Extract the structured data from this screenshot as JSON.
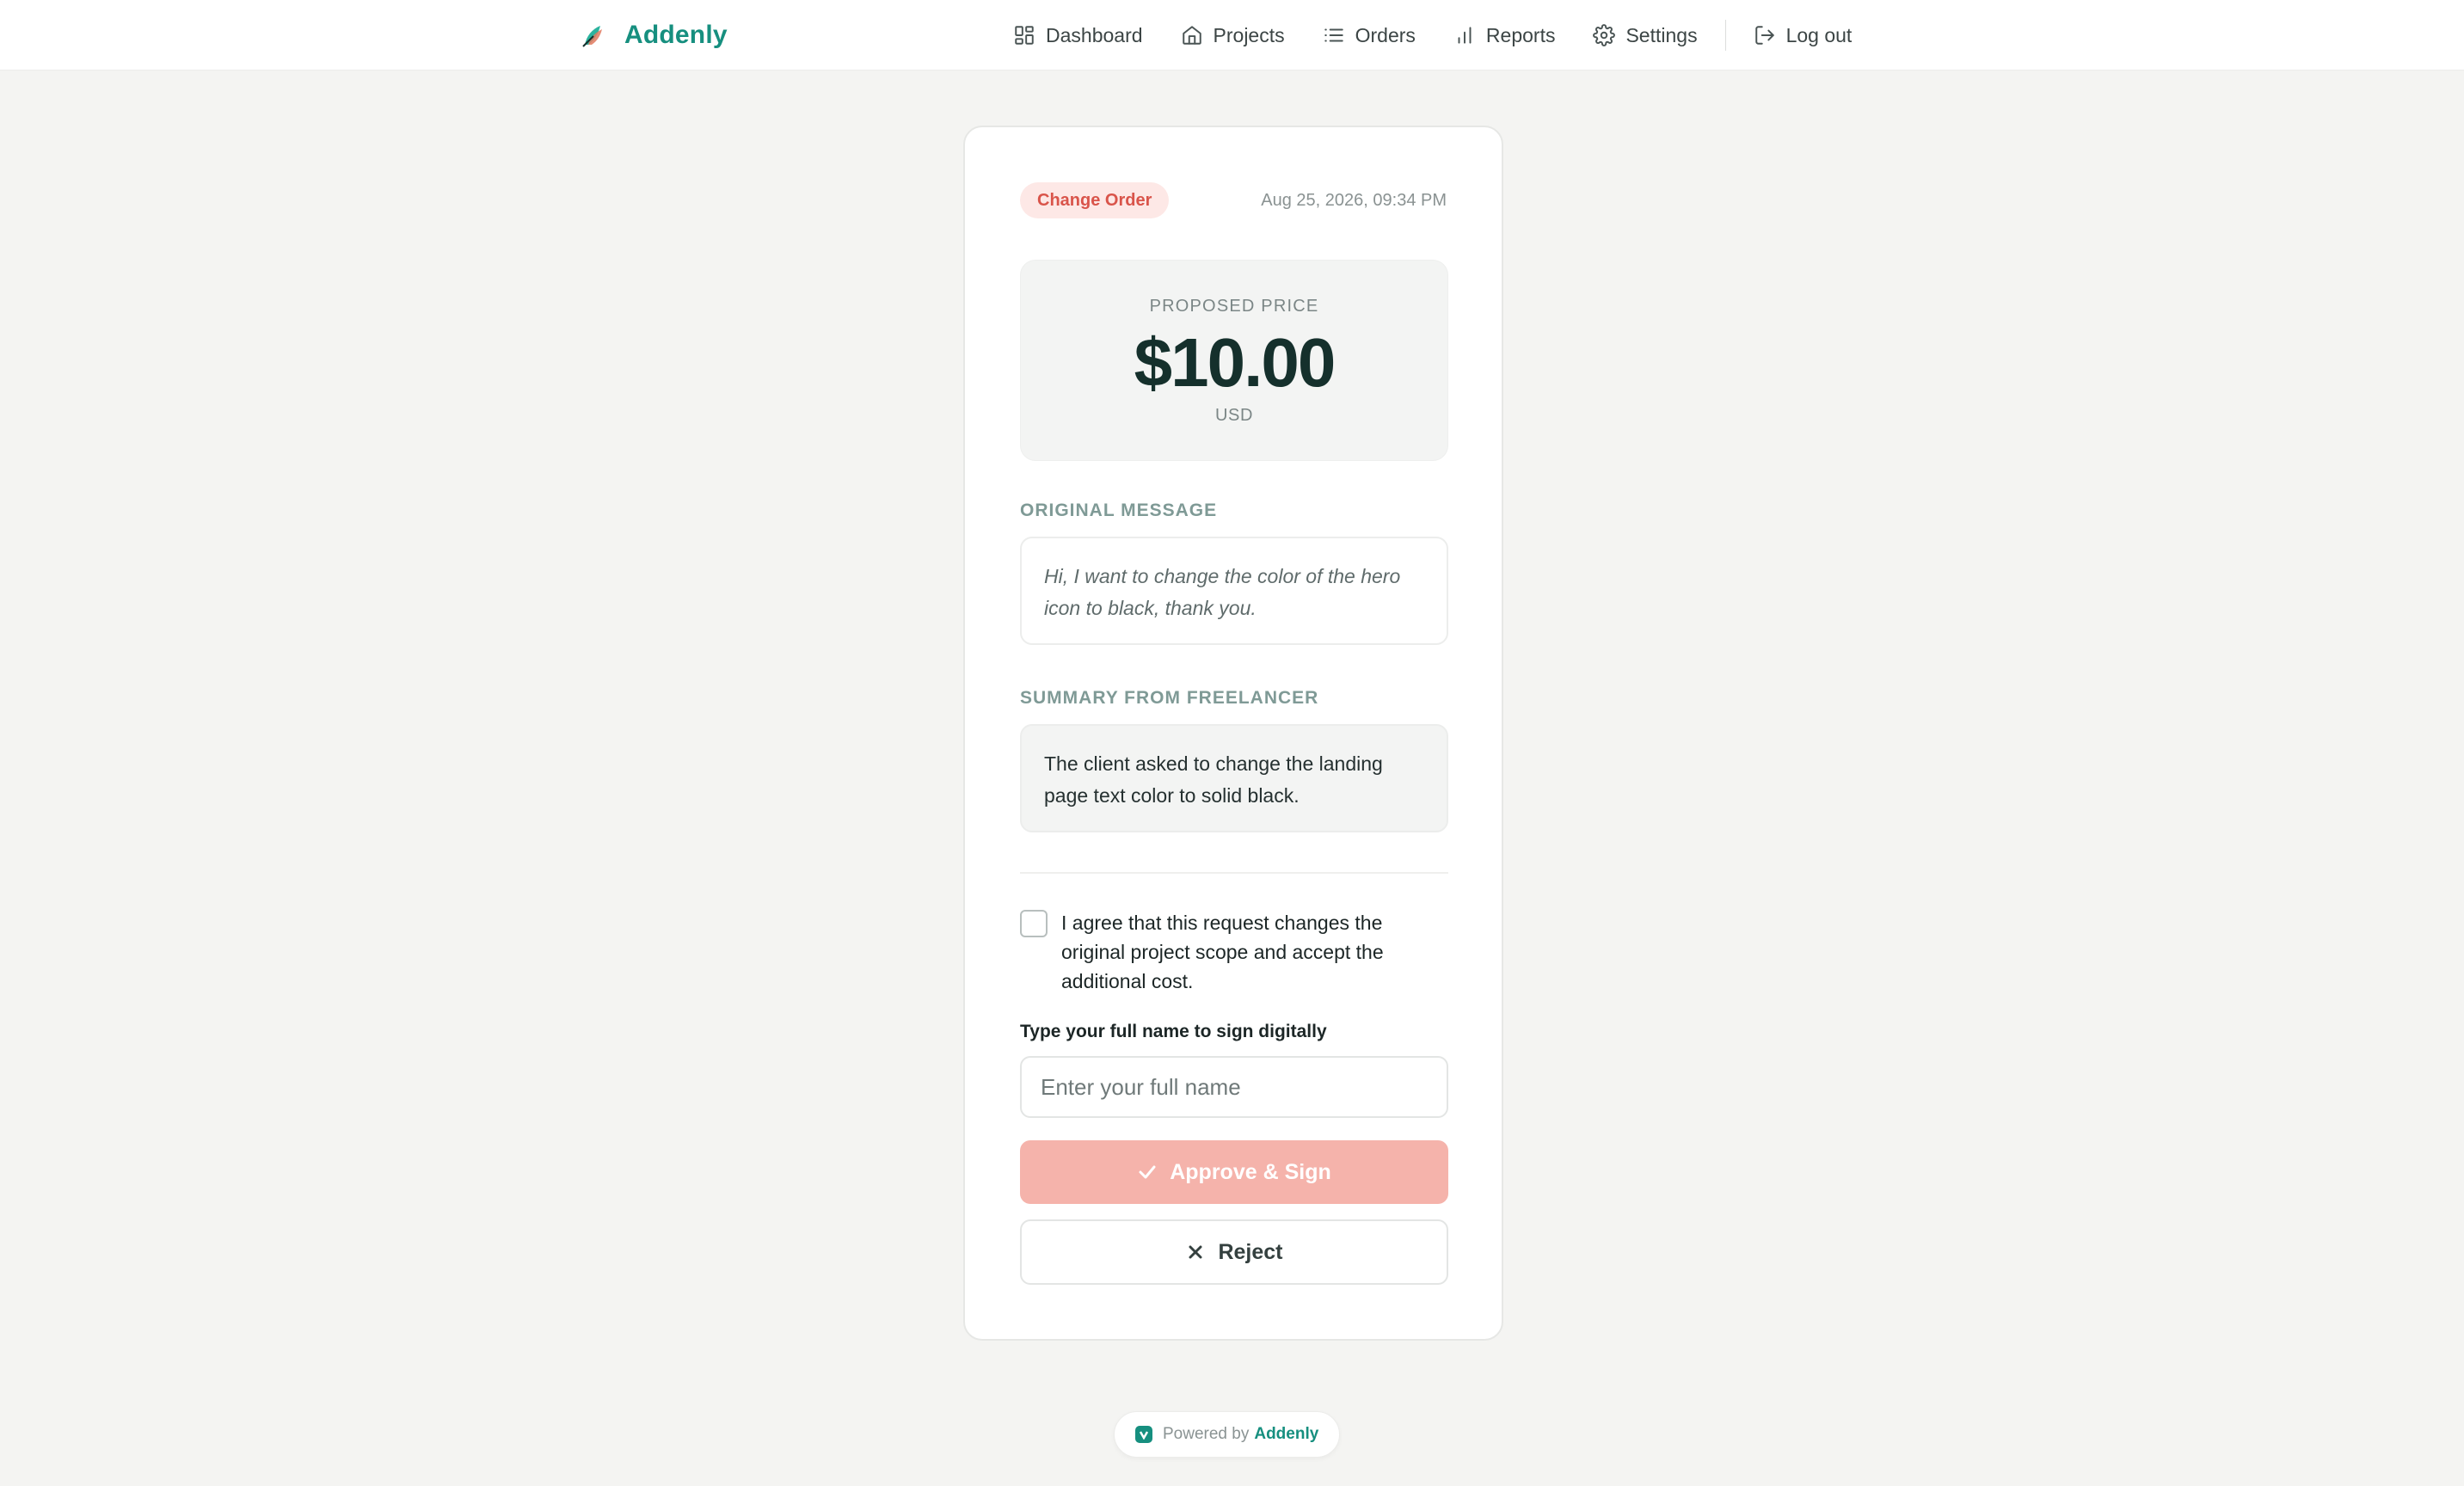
{
  "header": {
    "brand": "Addenly",
    "nav": [
      {
        "label": "Dashboard",
        "icon": "dashboard-icon"
      },
      {
        "label": "Projects",
        "icon": "home-icon"
      },
      {
        "label": "Orders",
        "icon": "list-icon"
      },
      {
        "label": "Reports",
        "icon": "bar-chart-icon"
      },
      {
        "label": "Settings",
        "icon": "gear-icon"
      }
    ],
    "logout": {
      "label": "Log out",
      "icon": "logout-icon"
    }
  },
  "card": {
    "badge": "Change Order",
    "timestamp": "Aug 25, 2026, 09:34 PM",
    "price": {
      "label": "PROPOSED PRICE",
      "value": "$10.00",
      "currency": "USD"
    },
    "original_message": {
      "label": "ORIGINAL MESSAGE",
      "text": "Hi, I want to change the color of the hero icon to black, thank you."
    },
    "summary": {
      "label": "SUMMARY FROM FREELANCER",
      "text": "The client asked to change the landing page text color to solid black."
    },
    "agreement": {
      "checked": false,
      "text": "I agree that this request changes the original project scope and accept the additional cost."
    },
    "signature": {
      "label": "Type your full name to sign digitally",
      "placeholder": "Enter your full name",
      "value": ""
    },
    "approve_label": "Approve & Sign",
    "reject_label": "Reject"
  },
  "footer": {
    "powered_prefix": "Powered by",
    "powered_brand": "Addenly"
  },
  "colors": {
    "brand": "#168f7f",
    "badge_bg": "#fde8e6",
    "badge_text": "#d9544a",
    "approve_bg": "#f5b3ab"
  }
}
